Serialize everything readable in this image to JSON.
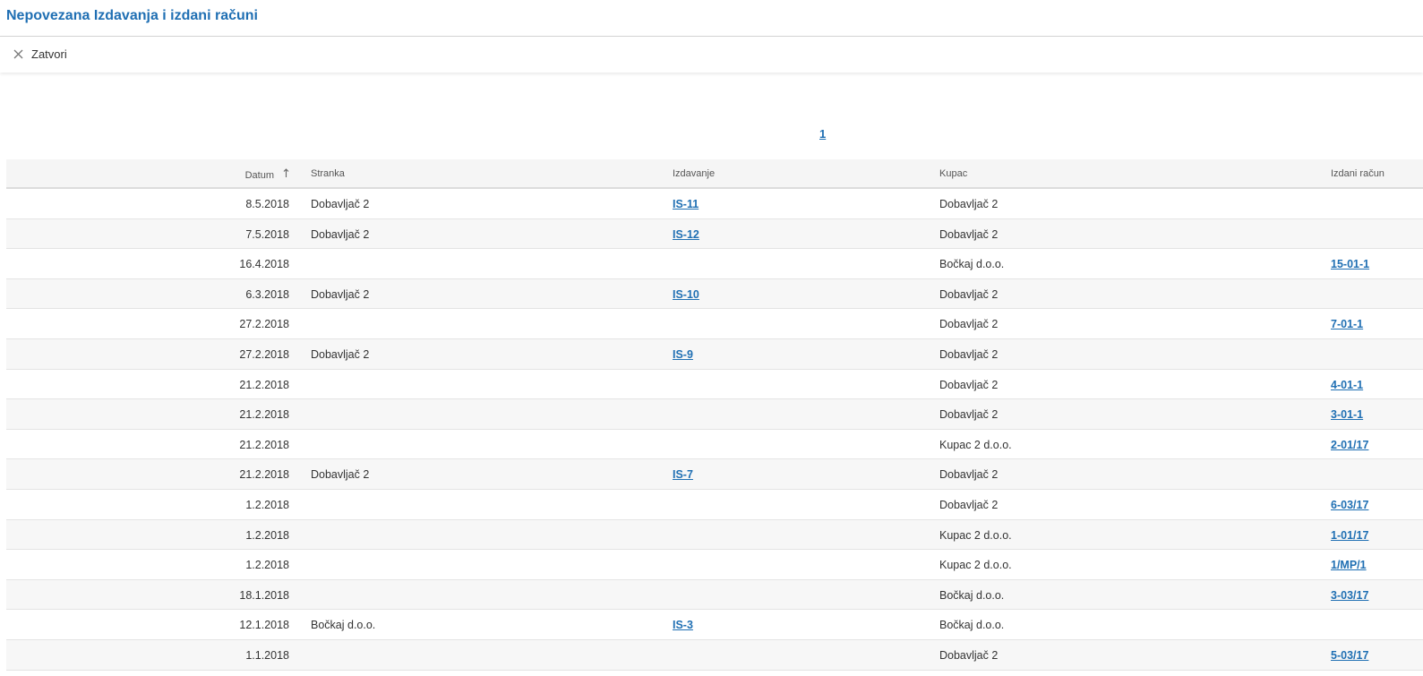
{
  "title": "Nepovezana Izdavanja i izdani računi",
  "toolbar": {
    "close_label": "Zatvori"
  },
  "pager": {
    "current": "1"
  },
  "columns": {
    "datum": "Datum",
    "stranka": "Stranka",
    "izdavanje": "Izdavanje",
    "kupac": "Kupac",
    "izdani_racun": "Izdani račun"
  },
  "rows": [
    {
      "datum": "8.5.2018",
      "stranka": "Dobavljač 2",
      "izdavanje": "IS-11",
      "kupac": "Dobavljač 2",
      "racun": ""
    },
    {
      "datum": "7.5.2018",
      "stranka": "Dobavljač 2",
      "izdavanje": "IS-12",
      "kupac": "Dobavljač 2",
      "racun": ""
    },
    {
      "datum": "16.4.2018",
      "stranka": "",
      "izdavanje": "",
      "kupac": "Bočkaj d.o.o.",
      "racun": "15-01-1"
    },
    {
      "datum": "6.3.2018",
      "stranka": "Dobavljač 2",
      "izdavanje": "IS-10",
      "kupac": "Dobavljač 2",
      "racun": ""
    },
    {
      "datum": "27.2.2018",
      "stranka": "",
      "izdavanje": "",
      "kupac": "Dobavljač 2",
      "racun": "7-01-1"
    },
    {
      "datum": "27.2.2018",
      "stranka": "Dobavljač 2",
      "izdavanje": "IS-9",
      "kupac": "Dobavljač 2",
      "racun": ""
    },
    {
      "datum": "21.2.2018",
      "stranka": "",
      "izdavanje": "",
      "kupac": "Dobavljač 2",
      "racun": "4-01-1"
    },
    {
      "datum": "21.2.2018",
      "stranka": "",
      "izdavanje": "",
      "kupac": "Dobavljač 2",
      "racun": "3-01-1"
    },
    {
      "datum": "21.2.2018",
      "stranka": "",
      "izdavanje": "",
      "kupac": "Kupac 2 d.o.o.",
      "racun": "2-01/17"
    },
    {
      "datum": "21.2.2018",
      "stranka": "Dobavljač 2",
      "izdavanje": "IS-7",
      "kupac": "Dobavljač 2",
      "racun": ""
    },
    {
      "datum": "1.2.2018",
      "stranka": "",
      "izdavanje": "",
      "kupac": "Dobavljač 2",
      "racun": "6-03/17"
    },
    {
      "datum": "1.2.2018",
      "stranka": "",
      "izdavanje": "",
      "kupac": "Kupac 2 d.o.o.",
      "racun": "1-01/17"
    },
    {
      "datum": "1.2.2018",
      "stranka": "",
      "izdavanje": "",
      "kupac": "Kupac 2 d.o.o.",
      "racun": "1/MP/1"
    },
    {
      "datum": "18.1.2018",
      "stranka": "",
      "izdavanje": "",
      "kupac": "Bočkaj d.o.o.",
      "racun": "3-03/17"
    },
    {
      "datum": "12.1.2018",
      "stranka": "Bočkaj d.o.o.",
      "izdavanje": "IS-3",
      "kupac": "Bočkaj d.o.o.",
      "racun": ""
    },
    {
      "datum": "1.1.2018",
      "stranka": "",
      "izdavanje": "",
      "kupac": "Dobavljač 2",
      "racun": "5-03/17"
    }
  ],
  "icons": {
    "close": "close-icon",
    "sort": "sort-ascending-icon"
  },
  "colors": {
    "accent": "#1f6fb3"
  }
}
